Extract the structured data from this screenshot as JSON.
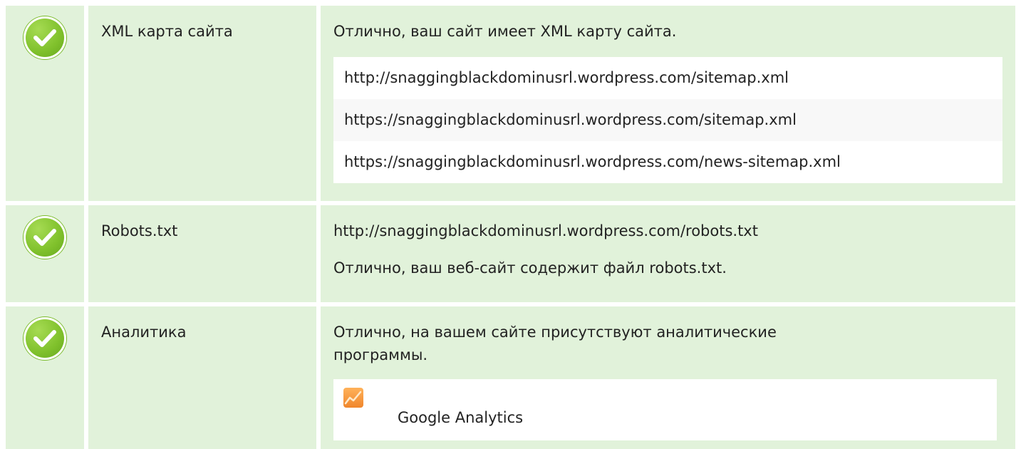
{
  "rows": [
    {
      "label": "XML карта сайта",
      "message": "Отлично, ваш сайт имеет XML карту сайта.",
      "urls": [
        "http://snaggingblackdominusrl.wordpress.com/sitemap.xml",
        "https://snaggingblackdominusrl.wordpress.com/sitemap.xml",
        "https://snaggingblackdominusrl.wordpress.com/news-sitemap.xml"
      ]
    },
    {
      "label": "Robots.txt",
      "url": "http://snaggingblackdominusrl.wordpress.com/robots.txt",
      "message": "Отлично, ваш веб-сайт содержит файл robots.txt."
    },
    {
      "label": "Аналитика",
      "message": "Отлично, на вашем сайте присутствуют аналитические программы.",
      "tool": {
        "name": "Google Analytics",
        "icon": "google-analytics-icon"
      }
    }
  ],
  "icons": {
    "status": "check-circle-icon"
  },
  "colors": {
    "row_background": "#e1f2da",
    "check_green": "#80c12c",
    "analytics_orange": "#f0862c"
  }
}
